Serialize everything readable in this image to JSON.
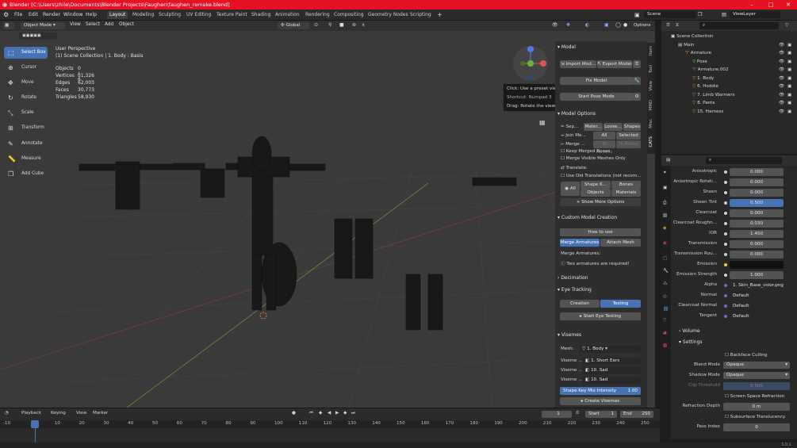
{
  "title": "Blender [C:\\Users\\zhile\\Documents\\Blender Projects\\Faughen\\faughen_remake.blend]",
  "menu": [
    "File",
    "Edit",
    "Render",
    "Window",
    "Help"
  ],
  "workspaces": [
    "Layout",
    "Modeling",
    "Sculpting",
    "UV Editing",
    "Texture Paint",
    "Shading",
    "Animation",
    "Rendering",
    "Compositing",
    "Geometry Nodes",
    "Scripting"
  ],
  "scene": "Scene",
  "view_layer": "ViewLayer",
  "viewport": {
    "mode": "Object Mode",
    "menus": [
      "View",
      "Select",
      "Add",
      "Object"
    ],
    "transform": "Global",
    "options": "Options",
    "perspective": "User Perspective",
    "collection": "(1) Scene Collection | 1. Body : Basis",
    "stats": [
      {
        "k": "Objects",
        "v": "0 / 6"
      },
      {
        "k": "Vertices",
        "v": "31,326"
      },
      {
        "k": "Edges",
        "v": "62,003"
      },
      {
        "k": "Faces",
        "v": "30,773"
      },
      {
        "k": "Triangles",
        "v": "58,930"
      }
    ],
    "tools": [
      "Select Box",
      "Cursor",
      "Move",
      "Rotate",
      "Scale",
      "Transform",
      "Annotate",
      "Measure",
      "Add Cube"
    ],
    "tooltip": [
      "Click: Use a preset viewport",
      "Shortcut: Numpad 3",
      "Drag: Rotate the view"
    ]
  },
  "side_tabs": [
    "Item",
    "Tool",
    "View",
    "MMD",
    "Misc",
    "CATS"
  ],
  "cats": {
    "model": "Model",
    "import": "Import Mod...",
    "export": "Export Model",
    "fix": "Fix Model",
    "pose": "Start Pose Mode",
    "model_options": "Model Options",
    "sep": "Sep...",
    "sep_opts": [
      "Mater...",
      "Loose...",
      "Shapes"
    ],
    "join": "Join Me...",
    "join_opts": [
      "All",
      "Selected"
    ],
    "merge": "Merge ...",
    "merge_opts": [
      "To Parents",
      "To Active"
    ],
    "keep_bones": "Keep Merged Bones",
    "merge_visible": "Merge Visible Meshes Only",
    "translate": "Translate:",
    "old_trans": "Use Old Translations (not recom...",
    "trans_all": "All",
    "trans_opts": [
      "Shape K...",
      "Bones",
      "Objects",
      "Materials"
    ],
    "more": "Show More Options",
    "custom": "Custom Model Creation",
    "howto": "How to use",
    "merge_arm": "Merge Armatures",
    "attach": "Attach Mesh",
    "merge_arm_lbl": "Merge Armatures:",
    "warn": "Two armatures are required!",
    "decimation": "Decimation",
    "eye": "Eye Tracking",
    "eye_tabs": [
      "Creation",
      "Testing"
    ],
    "eye_btn": "Start Eye Testing",
    "visemes": "Visemes",
    "mesh_lbl": "Mesh:",
    "mesh_val": "1. Body",
    "vis_rows": [
      {
        "k": "Viseme ...",
        "v": "1. Short Ears"
      },
      {
        "k": "Viseme ...",
        "v": "10. Sad"
      },
      {
        "k": "Viseme ...",
        "v": "10. Sad"
      }
    ],
    "intensity_lbl": "Shape Key Mix Intensity",
    "intensity_val": "1.00",
    "create_vis": "Create Visemes"
  },
  "outliner": {
    "items": [
      {
        "name": "Scene Collection",
        "d": 0
      },
      {
        "name": "Main",
        "d": 1
      },
      {
        "name": "Armature",
        "d": 2
      },
      {
        "name": "Pose",
        "d": 3
      },
      {
        "name": "Armature.002",
        "d": 3
      },
      {
        "name": "1. Body",
        "d": 3
      },
      {
        "name": "6. Hoddie",
        "d": 3
      },
      {
        "name": "7. Limb Warmers",
        "d": 3
      },
      {
        "name": "8. Pants",
        "d": 3
      },
      {
        "name": "15. Harness",
        "d": 3
      }
    ]
  },
  "props": [
    {
      "k": "Anisotropic",
      "v": "0.000",
      "dot": "w"
    },
    {
      "k": "Anisotropic Rotati...",
      "v": "0.000",
      "dot": "w"
    },
    {
      "k": "Sheen",
      "v": "0.000",
      "dot": "w"
    },
    {
      "k": "Sheen Tint",
      "v": "0.500",
      "dot": "w",
      "blue": true
    },
    {
      "k": "Clearcoat",
      "v": "0.000",
      "dot": "w"
    },
    {
      "k": "Clearcoat Roughn...",
      "v": "0.030",
      "dot": "w"
    },
    {
      "k": "IOR",
      "v": "1.450",
      "dot": "w"
    },
    {
      "k": "Transmission",
      "v": "0.000",
      "dot": "w"
    },
    {
      "k": "Transmission Rou...",
      "v": "0.000",
      "dot": "w"
    },
    {
      "k": "Emission",
      "v": "",
      "dot": "y"
    },
    {
      "k": "Emission Strength",
      "v": "1.000",
      "dot": "w"
    },
    {
      "k": "Alpha",
      "v": "1. Skin_Base_color.png",
      "dot": "b"
    },
    {
      "k": "Normal",
      "v": "Default",
      "dot": "b"
    },
    {
      "k": "Clearcoat Normal",
      "v": "Default",
      "dot": "b"
    },
    {
      "k": "Tangent",
      "v": "Default",
      "dot": "b"
    }
  ],
  "volume": "Volume",
  "settings": "Settings",
  "backface": "Backface Culling",
  "blend_lbl": "Blend Mode",
  "blend_val": "Opaque",
  "shadow_lbl": "Shadow Mode",
  "shadow_val": "Opaque",
  "clip_lbl": "Clip Threshold",
  "clip_val": "0.500",
  "ssr": "Screen Space Refraction",
  "refr_lbl": "Refraction Depth",
  "refr_val": "0 m",
  "sst": "Subsurface Translucency",
  "pass_lbl": "Pass Index",
  "pass_val": "0",
  "timeline": {
    "menus": [
      "Playback",
      "Keying",
      "View",
      "Marker"
    ],
    "current": "1",
    "start_lbl": "Start",
    "start": "1",
    "end_lbl": "End",
    "end": "250",
    "ticks": [
      "-10",
      "1",
      "10",
      "20",
      "30",
      "40",
      "50",
      "60",
      "70",
      "80",
      "90",
      "100",
      "110",
      "120",
      "130",
      "140",
      "150",
      "160",
      "170",
      "180",
      "190",
      "200",
      "210",
      "220",
      "230",
      "240",
      "250"
    ]
  },
  "version": "3.0.1",
  "colors": {
    "accent": "#4772b3",
    "title": "#e81123"
  }
}
